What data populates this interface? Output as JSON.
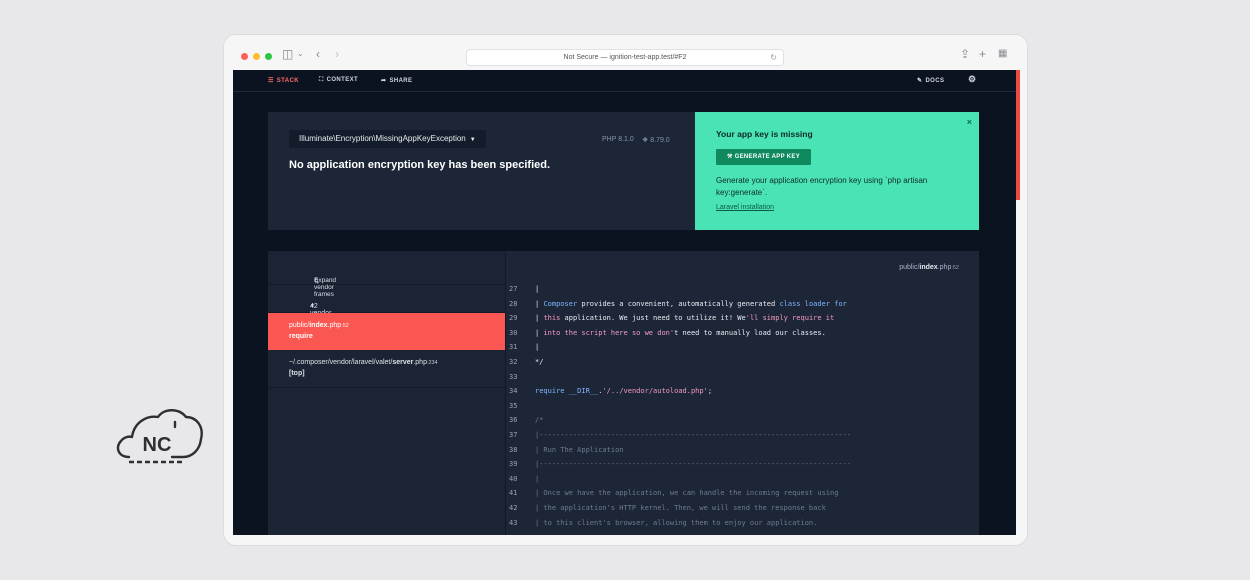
{
  "browser": {
    "url": "Not Secure — ignition-test-app.test/#F2",
    "traffic_lights": [
      "#fe5f57",
      "#febc2e",
      "#28c840"
    ]
  },
  "nav": {
    "stack": "STACK",
    "context": "CONTEXT",
    "share": "SHARE",
    "docs": "DOCS"
  },
  "error": {
    "exception": "Illuminate\\Encryption\\MissingAppKeyException",
    "php_version": "PHP 8.1.0",
    "laravel_version": "8.79.0",
    "message": "No application encryption key has been specified."
  },
  "solution": {
    "title": "Your app key is missing",
    "button": "GENERATE APP KEY",
    "description": "Generate your application encryption key using `php artisan key:generate`.",
    "link": "Laravel installation"
  },
  "frames": {
    "expand": "Expand vendor frames",
    "vendor_count": "42 vendor frames",
    "items": [
      {
        "path_pre": "public/",
        "path_bold": "index",
        "path_post": ".php",
        "line": "52",
        "func": "require"
      },
      {
        "path_pre": "~/.composer/vendor/laravel/valet/",
        "path_bold": "server",
        "path_post": ".php",
        "line": "234",
        "func": "[top]"
      }
    ]
  },
  "code": {
    "file_pre": "public/",
    "file_bold": "index",
    "file_post": ".php",
    "file_line": "52",
    "lines": [
      {
        "n": "27",
        "segments": [
          {
            "c": "wht",
            "t": "|"
          }
        ]
      },
      {
        "n": "28",
        "segments": [
          {
            "c": "wht",
            "t": "| "
          },
          {
            "c": "blue",
            "t": "Composer"
          },
          {
            "c": "wht",
            "t": " provides a convenient, automatically generated "
          },
          {
            "c": "blue",
            "t": "class loader for"
          }
        ]
      },
      {
        "n": "29",
        "segments": [
          {
            "c": "wht",
            "t": "| "
          },
          {
            "c": "pink",
            "t": "this"
          },
          {
            "c": "wht",
            "t": " application. We just need to utilize it! We"
          },
          {
            "c": "pink",
            "t": "'ll simply require it"
          }
        ]
      },
      {
        "n": "30",
        "segments": [
          {
            "c": "wht",
            "t": "| "
          },
          {
            "c": "pink",
            "t": "into the script here so we don'"
          },
          {
            "c": "wht",
            "t": "t need to manually load our classes."
          }
        ]
      },
      {
        "n": "31",
        "segments": [
          {
            "c": "wht",
            "t": "|"
          }
        ]
      },
      {
        "n": "32",
        "segments": [
          {
            "c": "wht",
            "t": "*/"
          }
        ]
      },
      {
        "n": "33",
        "segments": []
      },
      {
        "n": "34",
        "segments": [
          {
            "c": "blue",
            "t": "require"
          },
          {
            "c": "wht",
            "t": " "
          },
          {
            "c": "blue",
            "t": "__DIR__"
          },
          {
            "c": "wht",
            "t": "."
          },
          {
            "c": "pink",
            "t": "'/../vendor/autoload.php'"
          },
          {
            "c": "wht",
            "t": ";"
          }
        ]
      },
      {
        "n": "35",
        "segments": []
      },
      {
        "n": "36",
        "segments": [
          {
            "c": "gray",
            "t": "/*"
          }
        ]
      },
      {
        "n": "37",
        "segments": [
          {
            "c": "gray",
            "t": "|--------------------------------------------------------------------------"
          }
        ]
      },
      {
        "n": "38",
        "segments": [
          {
            "c": "gray",
            "t": "| Run The Application"
          }
        ]
      },
      {
        "n": "39",
        "segments": [
          {
            "c": "gray",
            "t": "|--------------------------------------------------------------------------"
          }
        ]
      },
      {
        "n": "40",
        "segments": [
          {
            "c": "gray",
            "t": "|"
          }
        ]
      },
      {
        "n": "41",
        "segments": [
          {
            "c": "gray",
            "t": "| Once we have the application, we can handle the incoming request using"
          }
        ]
      },
      {
        "n": "42",
        "segments": [
          {
            "c": "gray",
            "t": "| the application's HTTP kernel. Then, we will send the response back"
          }
        ]
      },
      {
        "n": "43",
        "segments": [
          {
            "c": "gray",
            "t": "| to this client's browser, allowing them to enjoy our application."
          }
        ]
      }
    ]
  },
  "logo": {
    "text": "NC"
  }
}
